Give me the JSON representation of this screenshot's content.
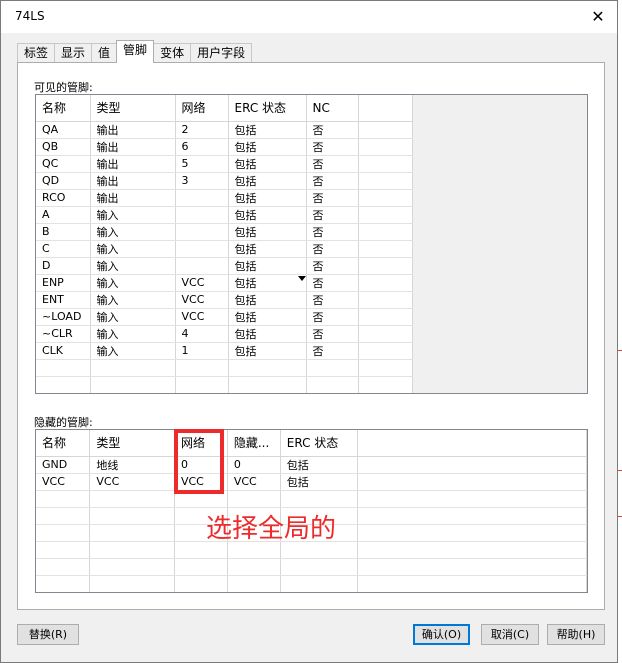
{
  "window": {
    "title": "74LS",
    "close_glyph": "✕"
  },
  "tabs": [
    {
      "label": "标签"
    },
    {
      "label": "显示"
    },
    {
      "label": "值"
    },
    {
      "label": "管脚",
      "active": true
    },
    {
      "label": "变体"
    },
    {
      "label": "用户字段"
    }
  ],
  "visible_pins": {
    "label": "可见的管脚:",
    "columns": [
      "名称",
      "类型",
      "网络",
      "ERC 状态",
      "NC"
    ],
    "rows": [
      [
        "QA",
        "输出",
        "2",
        "包括",
        "否"
      ],
      [
        "QB",
        "输出",
        "6",
        "包括",
        "否"
      ],
      [
        "QC",
        "输出",
        "5",
        "包括",
        "否"
      ],
      [
        "QD",
        "输出",
        "3",
        "包括",
        "否"
      ],
      [
        "RCO",
        "输出",
        "",
        "包括",
        "否"
      ],
      [
        "A",
        "输入",
        "",
        "包括",
        "否"
      ],
      [
        "B",
        "输入",
        "",
        "包括",
        "否"
      ],
      [
        "C",
        "输入",
        "",
        "包括",
        "否"
      ],
      [
        "D",
        "输入",
        "",
        "包括",
        "否"
      ],
      [
        "ENP",
        "输入",
        "VCC",
        "包括",
        "否"
      ],
      [
        "ENT",
        "输入",
        "VCC",
        "包括",
        "否"
      ],
      [
        "~LOAD",
        "输入",
        "VCC",
        "包括",
        "否"
      ],
      [
        "~CLR",
        "输入",
        "4",
        "包括",
        "否"
      ],
      [
        "CLK",
        "输入",
        "1",
        "包括",
        "否"
      ]
    ]
  },
  "hidden_pins": {
    "label": "隐藏的管脚:",
    "columns": [
      "名称",
      "类型",
      "网络",
      "隐藏...",
      "ERC 状态"
    ],
    "rows": [
      [
        "GND",
        "地线",
        "0",
        "0",
        "包括"
      ],
      [
        "VCC",
        "VCC",
        "VCC",
        "VCC",
        "包括"
      ]
    ]
  },
  "annotation": {
    "text": "选择全局的",
    "color": "#ee2b2b"
  },
  "buttons": {
    "replace": "替换(R)",
    "ok": "确认(O)",
    "cancel": "取消(C)",
    "help": "帮助(H)"
  },
  "colors": {
    "accent": "#0078d7",
    "annotation": "#ee2b2b"
  }
}
